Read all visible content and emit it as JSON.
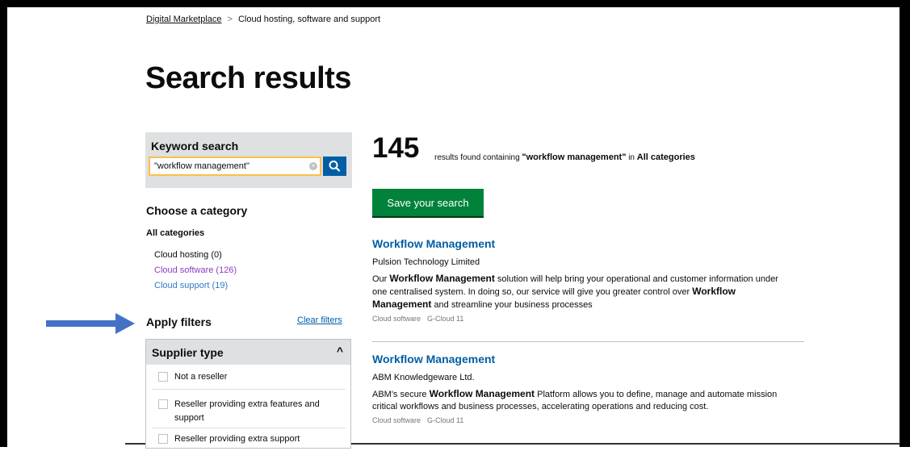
{
  "breadcrumb": {
    "home": "Digital Marketplace",
    "separator": ">",
    "current": "Cloud hosting, software and support"
  },
  "page_title": "Search results",
  "keyword_search": {
    "label": "Keyword search",
    "value": "\"workflow management\"",
    "clear_glyph": "×"
  },
  "categories": {
    "title": "Choose a category",
    "all_label": "All categories",
    "items": [
      {
        "label": "Cloud hosting (0)",
        "color": "#0b0c0c"
      },
      {
        "label": "Cloud software (126)",
        "color": "#8a3ec2"
      },
      {
        "label": "Cloud support (19)",
        "color": "#2f7cc4"
      }
    ]
  },
  "filters": {
    "title": "Apply filters",
    "clear_label": "Clear filters",
    "supplier_type": {
      "title": "Supplier type",
      "caret": "^",
      "options": [
        "Not a reseller",
        "Reseller providing extra features and support",
        "Reseller providing extra support"
      ]
    }
  },
  "results_summary": {
    "count": "145",
    "prefix": "results found containing",
    "query": "\"workflow management\"",
    "connector": "in",
    "category": "All categories"
  },
  "save_search_label": "Save your search",
  "results": [
    {
      "title": "Workflow Management",
      "supplier": "Pulsion Technology Limited",
      "desc_parts": [
        "Our ",
        "Workflow Management",
        " solution will help bring your operational and customer information under one centralised system. In doing so, our service will give you greater control over ",
        "Workflow Management",
        " and streamline your business processes"
      ],
      "lot": "Cloud software",
      "framework": "G-Cloud 11"
    },
    {
      "title": "Workflow Management",
      "supplier": "ABM Knowledgeware Ltd.",
      "desc_parts": [
        "ABM's secure ",
        "Workflow Management",
        " Platform allows you to define, manage and automate mission critical workflows and business processes, accelerating operations and reducing cost."
      ],
      "lot": "Cloud software",
      "framework": "G-Cloud 11"
    }
  ],
  "colors": {
    "link": "#005ea5",
    "save_button": "#00823b",
    "search_button": "#005ea5",
    "focus_border": "#ffbf47",
    "panel_grey": "#dee0e2",
    "annotation_arrow": "#4472c4"
  },
  "icons": {
    "search_button": "search-icon",
    "annotation": "arrow-right-icon"
  }
}
